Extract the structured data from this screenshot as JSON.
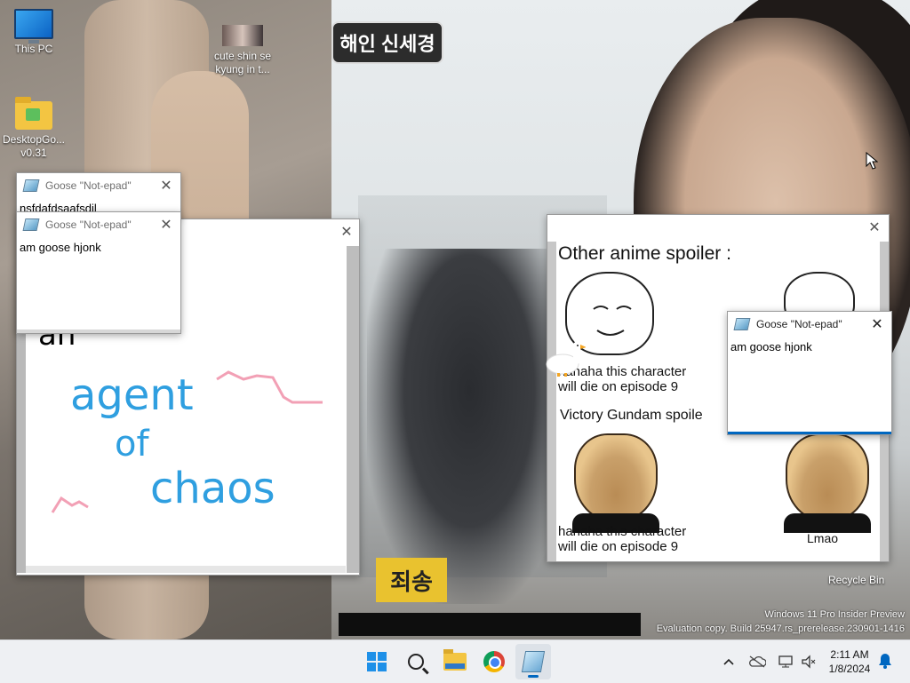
{
  "desktop": {
    "icons": [
      {
        "label": "This PC"
      },
      {
        "label": "cute shin se kyung in t..."
      },
      {
        "label": "DesktopGo...\nv0.31"
      }
    ],
    "recycle_bin": "Recycle Bin",
    "watermark": {
      "line1": "Windows 11 Pro Insider Preview",
      "line2": "Evaluation copy. Build 25947.rs_prerelease.230901-1416"
    },
    "wallpaper_caption": "해인 신세경",
    "wallpaper_sticker": "죄송"
  },
  "notepad_back": {
    "title": "Goose \"Not-epad\"",
    "text": "nsfdafdsaafsdjl"
  },
  "notepad_front": {
    "title": "Goose \"Not-epad\"",
    "text": "am goose hjonk"
  },
  "notepad_right": {
    "title": "Goose \"Not-epad\"",
    "text": "am goose hjonk"
  },
  "paint_window": {
    "scrawl": {
      "line1": "an",
      "line2": "agent",
      "line3": "of",
      "line4": "chaos"
    }
  },
  "meme_window": {
    "heading": "Other anime spoiler :",
    "top_caption": "hahaha this character\nwill die on episode 9",
    "middle_heading": "Victory Gundam spoile",
    "bottom_left_caption": "hahaha this character\nwill die on episode 9",
    "bottom_right_caption": "Lmao"
  },
  "taskbar": {
    "time": "2:11 AM",
    "date": "1/8/2024",
    "apps": [
      {
        "name": "start-icon"
      },
      {
        "name": "search-icon"
      },
      {
        "name": "file-explorer-icon"
      },
      {
        "name": "chrome-icon"
      },
      {
        "name": "notepad-icon",
        "active": true
      }
    ],
    "tray": [
      "chevron-up-icon",
      "onedrive-icon",
      "network-icon",
      "volume-muted-icon"
    ]
  },
  "colors": {
    "accent": "#0067c0",
    "scrawl_blue": "#2f9fe0",
    "scrawl_pink": "#f2a0b5",
    "taskbar_bg": "#eef0f3"
  }
}
